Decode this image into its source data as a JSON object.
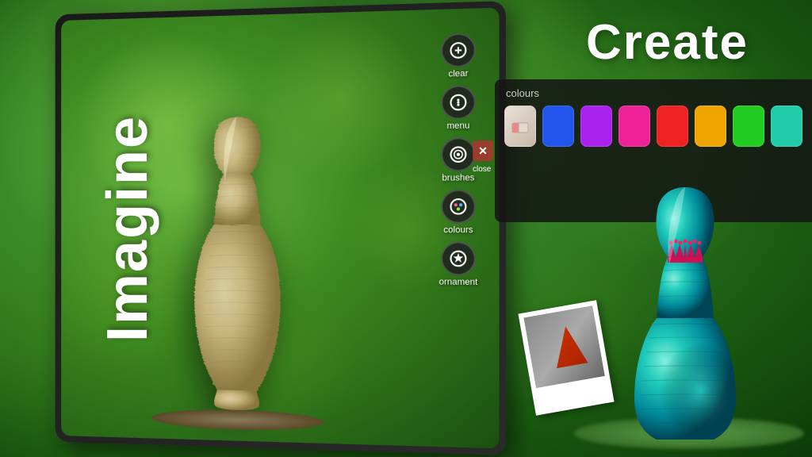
{
  "app": {
    "imagine_label": "Imagine",
    "create_label": "Create"
  },
  "toolbar": {
    "items": [
      {
        "id": "clear",
        "label": "clear",
        "icon": "⌂"
      },
      {
        "id": "menu",
        "label": "menu",
        "icon": "⌂"
      },
      {
        "id": "brushes",
        "label": "brushes",
        "icon": "✿"
      },
      {
        "id": "colours",
        "label": "colours",
        "icon": "✿"
      },
      {
        "id": "ornament",
        "label": "ornament",
        "icon": "✿"
      }
    ]
  },
  "colours_panel": {
    "label": "colours",
    "swatches": [
      {
        "id": "eraser",
        "color": "eraser",
        "label": "eraser"
      },
      {
        "id": "blue",
        "color": "#2255ee",
        "label": "blue"
      },
      {
        "id": "purple",
        "color": "#aa22ee",
        "label": "purple"
      },
      {
        "id": "pink",
        "color": "#ee2299",
        "label": "pink"
      },
      {
        "id": "red",
        "color": "#ee2222",
        "label": "red"
      },
      {
        "id": "orange",
        "color": "#eea500",
        "label": "orange"
      },
      {
        "id": "green",
        "color": "#22cc22",
        "label": "green"
      },
      {
        "id": "teal",
        "color": "#22ccaa",
        "label": "teal"
      }
    ],
    "close_label": "close"
  }
}
